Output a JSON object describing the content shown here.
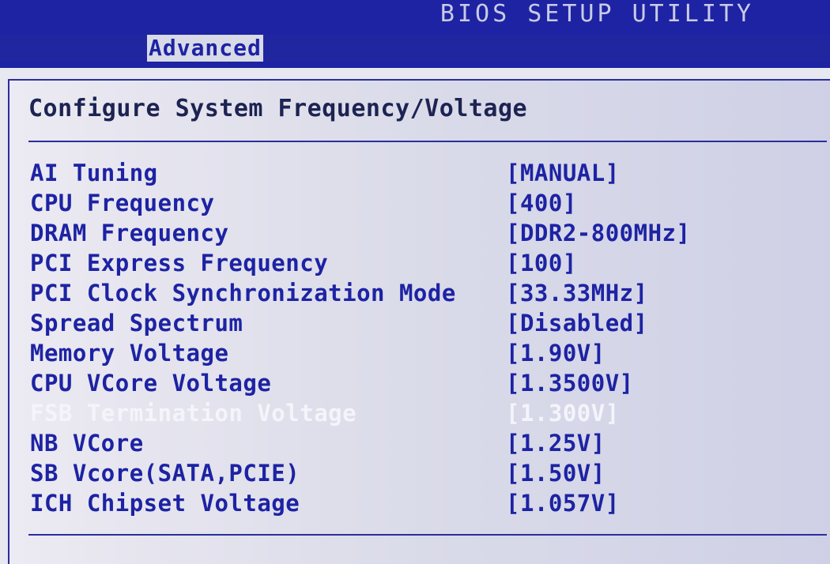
{
  "header": {
    "title": "BIOS SETUP UTILITY",
    "active_tab": "Advanced"
  },
  "page": {
    "heading": "Configure System Frequency/Voltage"
  },
  "settings": [
    {
      "label": "AI Tuning",
      "value": "[MANUAL]"
    },
    {
      "label": "CPU Frequency",
      "value": "[400]"
    },
    {
      "label": "DRAM Frequency",
      "value": "[DDR2-800MHz]"
    },
    {
      "label": "PCI Express Frequency",
      "value": "[100]"
    },
    {
      "label": "PCI Clock Synchronization Mode",
      "value": "[33.33MHz]"
    },
    {
      "label": "Spread Spectrum",
      "value": "[Disabled]"
    },
    {
      "label": "Memory Voltage",
      "value": "[1.90V]"
    },
    {
      "label": "CPU VCore Voltage",
      "value": "[1.3500V]"
    },
    {
      "label": "FSB Termination Voltage",
      "value": "[1.300V]"
    },
    {
      "label": "NB VCore",
      "value": "[1.25V]"
    },
    {
      "label": "SB Vcore(SATA,PCIE)",
      "value": "[1.50V]"
    },
    {
      "label": "ICH Chipset Voltage",
      "value": "[1.057V]"
    }
  ],
  "colors": {
    "background": "#1d23a3",
    "panel": "#e7e8f0",
    "text": "#1d23a3",
    "selected_text": "#f4f4fa"
  }
}
